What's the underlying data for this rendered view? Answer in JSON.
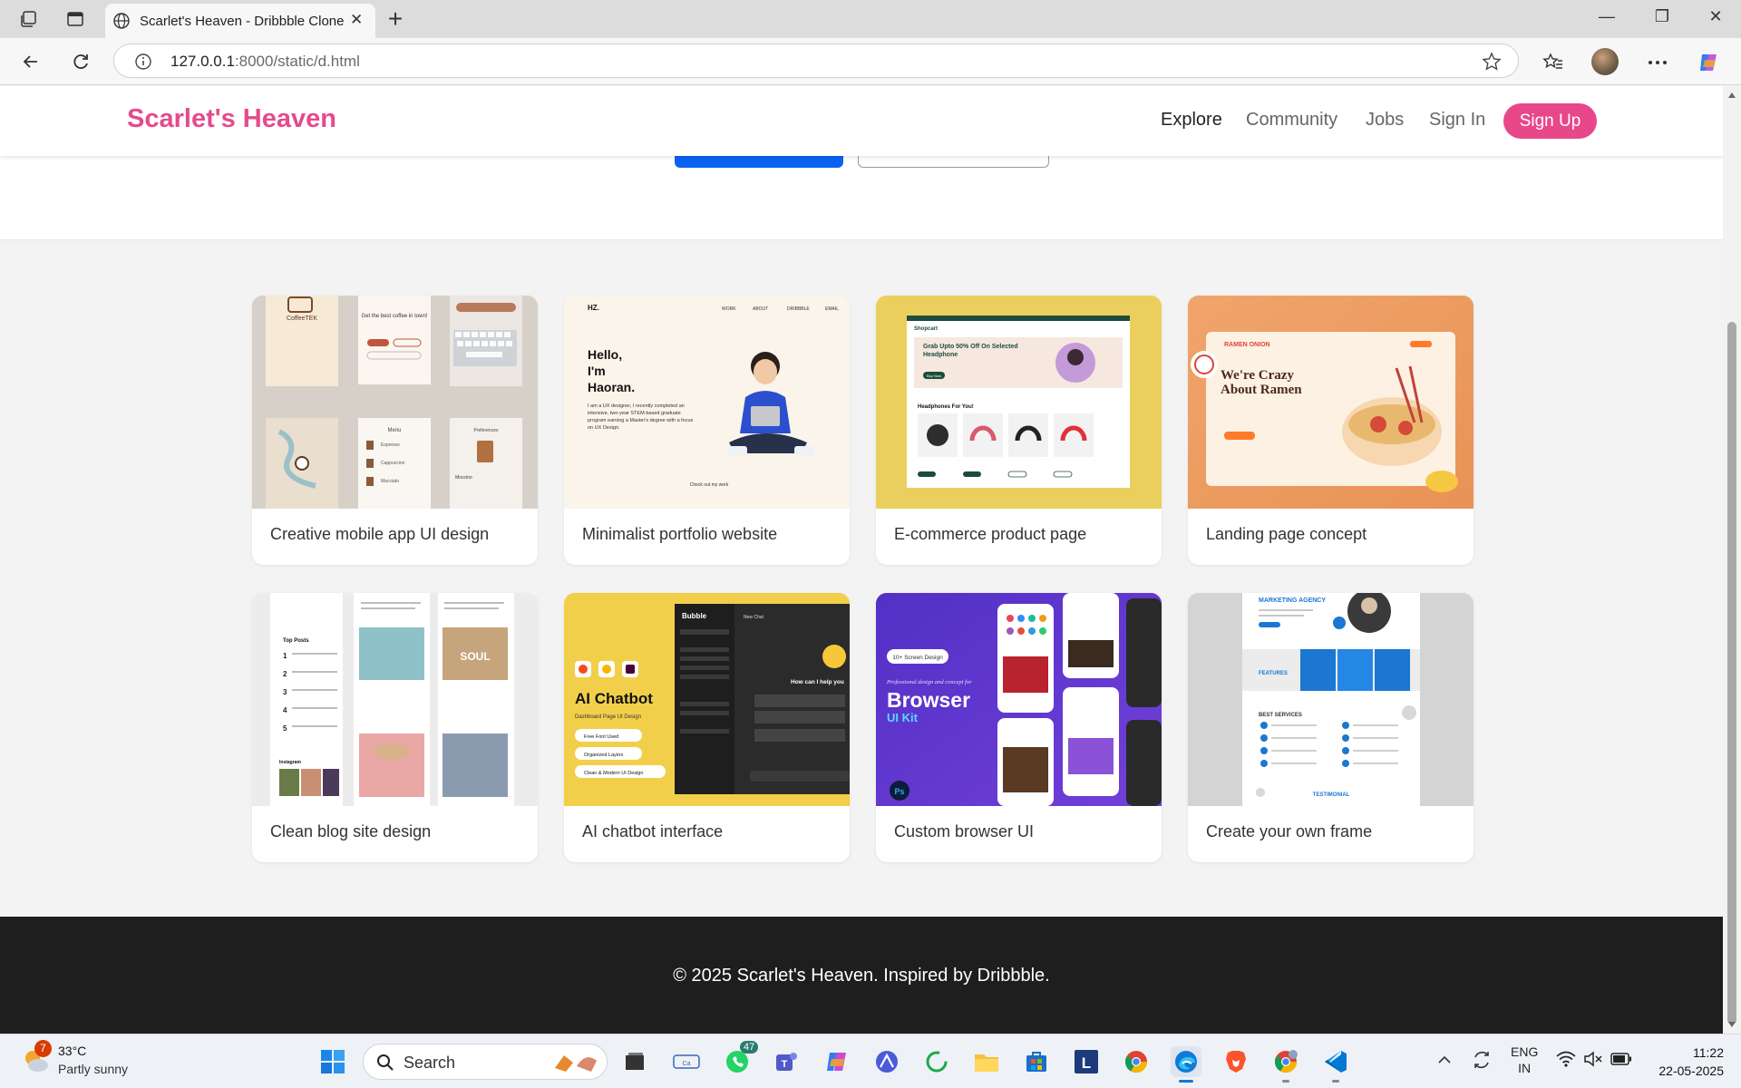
{
  "browser": {
    "tab_title": "Scarlet's Heaven - Dribbble Clone",
    "url_host": "127.0.0.1",
    "url_rest": ":8000/static/d.html"
  },
  "site": {
    "brand": "Scarlet's Heaven",
    "nav": [
      "Explore",
      "Community",
      "Jobs",
      "Sign In"
    ],
    "signup": "Sign Up",
    "accent": "#e8478a"
  },
  "shots": [
    {
      "title": "Creative mobile app UI design",
      "mock": {
        "app_name": "CoffeeTEK",
        "headline": "Get the best coffee in town!",
        "menu": "Menu",
        "prefs": "Preferences",
        "items": [
          "Espresso",
          "Cappuccino",
          "Macciato"
        ],
        "item": "Moccino"
      }
    },
    {
      "title": "Minimalist portfolio website",
      "mock": {
        "logo": "HZ.",
        "nav": [
          "WORK",
          "ABOUT",
          "DRIBBBLE",
          "EMAIL"
        ],
        "greeting": [
          "Hello,",
          "I'm",
          "Haoran."
        ],
        "bio": "I am a UX designer, I recently completed an intensive, two-year STEM-based graduate program earning a Master's degree with a focus on UX Design.",
        "cta": "Check out my work"
      }
    },
    {
      "title": "E-commerce product page",
      "mock": {
        "logo": "Shopcart",
        "headline": "Grab Upto 50% Off On Selected Headphone",
        "button": "Buy Now",
        "section": "Headphones For You!"
      }
    },
    {
      "title": "Landing page concept",
      "mock": {
        "logo": "RAMEN ONION",
        "headline": "We're Crazy About Ramen"
      }
    },
    {
      "title": "Clean blog site design",
      "mock": {
        "top_posts": "Top Posts",
        "instagram": "Instagram",
        "sign": "SOUL"
      }
    },
    {
      "title": "AI chatbot interface",
      "mock": {
        "headline": "AI Chatbot",
        "sub": "Dashboard Page UI Design",
        "features": [
          "Free Font Used",
          "Organized Layers",
          "Clean & Modern UI Design"
        ],
        "app": "Bubble",
        "new_chat": "New Chat",
        "prompt": "How can I help you"
      }
    },
    {
      "title": "Custom browser UI",
      "mock": {
        "badge": "10+ Screen Design",
        "script": "Professional design and concept for",
        "headline": "Browser",
        "sub": "UI Kit",
        "ps": "Ps"
      }
    },
    {
      "title": "Create your own frame",
      "mock": {
        "headline": "MARKETING AGENCY",
        "features": "FEATURES",
        "services": "BEST SERVICES",
        "testimonial": "TESTIMONIAL"
      }
    }
  ],
  "footer": "© 2025 Scarlet's Heaven. Inspired by Dribbble.",
  "taskbar": {
    "weather_badge": "7",
    "temp": "33°C",
    "condition": "Partly sunny",
    "search": "Search",
    "whatsapp_badge": "47",
    "lang": [
      "ENG",
      "IN"
    ],
    "time": "11:22",
    "date": "22-05-2025",
    "l_app": "L",
    "teams": "T",
    "ps": "Ps"
  }
}
